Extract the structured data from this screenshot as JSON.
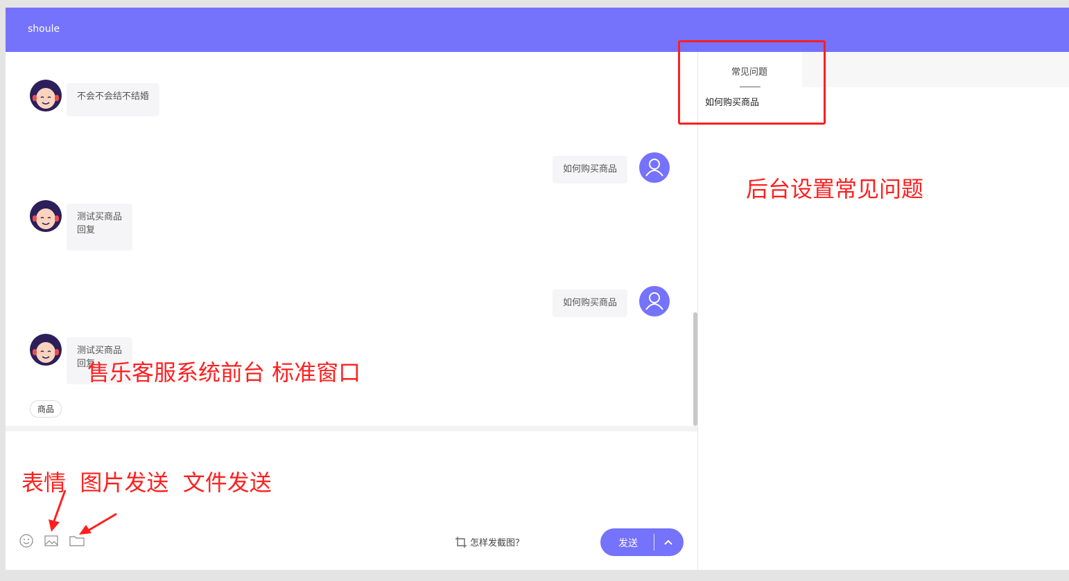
{
  "header": {
    "title": "shoule"
  },
  "messages": [
    {
      "from": "agent",
      "lines": [
        "不会不会结不结婚"
      ]
    },
    {
      "from": "user",
      "lines": [
        "如何购买商品"
      ]
    },
    {
      "from": "agent",
      "lines": [
        "测试买商品",
        "回复"
      ]
    },
    {
      "from": "user",
      "lines": [
        "如何购买商品"
      ]
    },
    {
      "from": "agent",
      "lines": [
        "测试买商品",
        "回复"
      ]
    }
  ],
  "quick_tag": "商品",
  "toolbar": {
    "emoji_icon": "smiley-icon",
    "image_icon": "image-icon",
    "file_icon": "folder-icon",
    "howto_text": "怎样发截图？",
    "send_label": "发送"
  },
  "sidebar": {
    "tab_label": "常见问题",
    "faq_items": [
      "如何购买商品"
    ]
  },
  "annotations": {
    "faq_note": "后台设置常见问题",
    "window_note": "售乐客服系统前台 标准窗口",
    "tools_note": "表情  图片发送  文件发送"
  },
  "colors": {
    "accent": "#7572fb",
    "annotation": "#ff1f1f"
  }
}
